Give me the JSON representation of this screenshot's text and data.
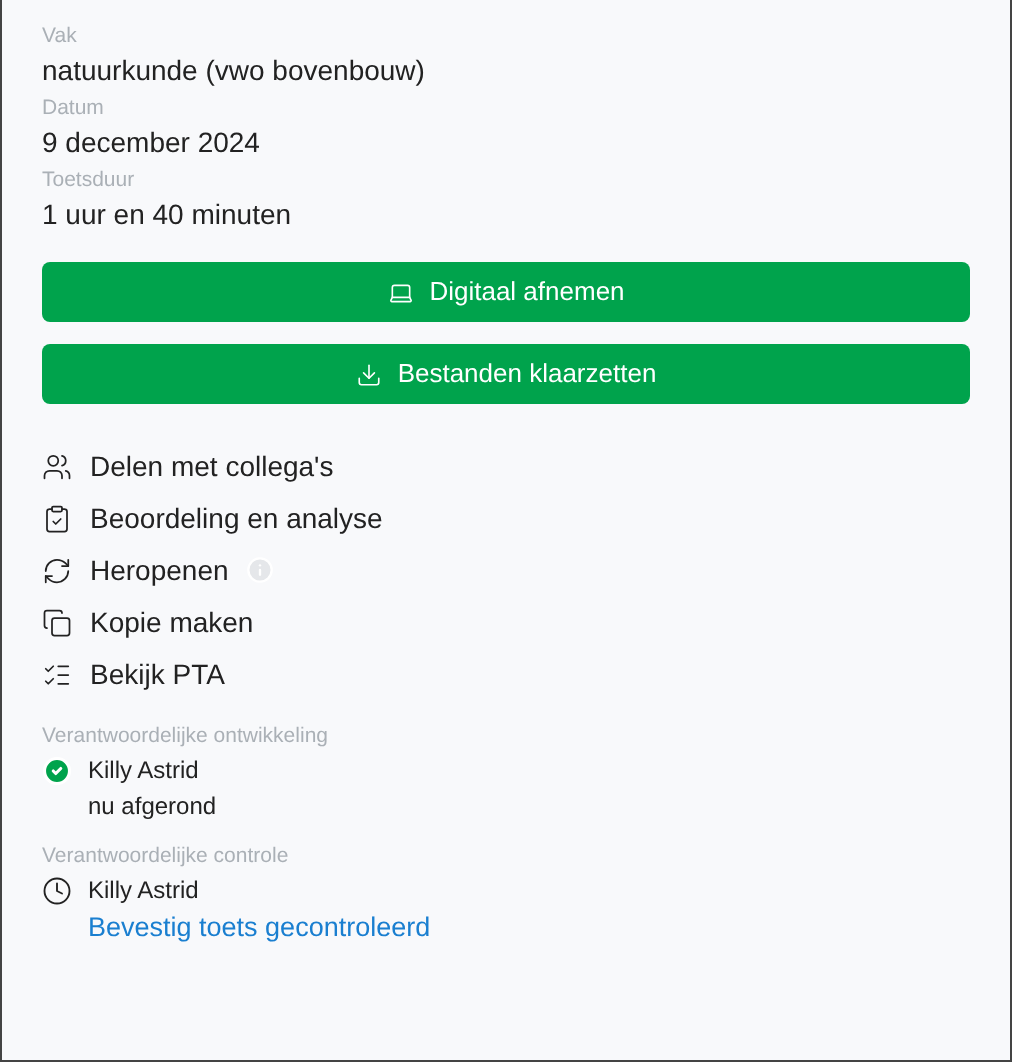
{
  "fields": [
    {
      "label": "Vak",
      "value": "natuurkunde (vwo bovenbouw)"
    },
    {
      "label": "Datum",
      "value": "9 december 2024"
    },
    {
      "label": "Toetsduur",
      "value": "1 uur en 40 minuten"
    }
  ],
  "buttons": [
    {
      "label": "Digitaal afnemen",
      "kind": "laptop"
    },
    {
      "label": "Bestanden klaarzetten",
      "kind": "download"
    }
  ],
  "actions": [
    {
      "label": "Delen met collega's",
      "kind": "share",
      "info": false
    },
    {
      "label": "Beoordeling en analyse",
      "kind": "review",
      "info": false
    },
    {
      "label": "Heropenen",
      "kind": "reopen",
      "info": true
    },
    {
      "label": "Kopie maken",
      "kind": "copy",
      "info": false
    },
    {
      "label": "Bekijk PTA",
      "kind": "list",
      "info": false
    }
  ],
  "responsibles": [
    {
      "label": "Verantwoordelijke ontwikkeling",
      "name": "Killy Astrid",
      "done": true,
      "note": {
        "kind": "text",
        "text": "nu afgerond"
      }
    },
    {
      "label": "Verantwoordelijke controle",
      "name": "Killy Astrid",
      "done": false,
      "note": {
        "kind": "link",
        "text": "Bevestig toets gecontroleerd"
      }
    }
  ]
}
